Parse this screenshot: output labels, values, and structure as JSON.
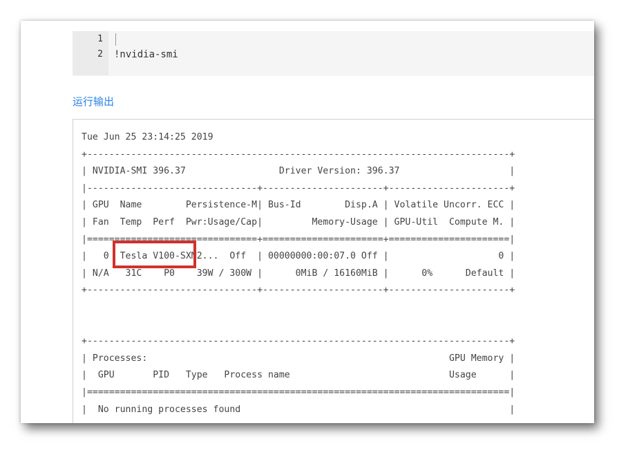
{
  "code_cell": {
    "line_numbers": [
      "1",
      "2"
    ],
    "lines": [
      "",
      "!nvidia-smi"
    ]
  },
  "output_section": {
    "label": "运行输出"
  },
  "output_text": "Tue Jun 25 23:14:25 2019\n+-----------------------------------------------------------------------------+\n| NVIDIA-SMI 396.37                 Driver Version: 396.37                    |\n|-------------------------------+----------------------+----------------------+\n| GPU  Name        Persistence-M| Bus-Id        Disp.A | Volatile Uncorr. ECC |\n| Fan  Temp  Perf  Pwr:Usage/Cap|         Memory-Usage | GPU-Util  Compute M. |\n|===============================+======================+======================|\n|   0  Tesla V100-SXM2...  Off  | 00000000:00:07.0 Off |                    0 |\n| N/A   31C    P0    39W / 300W |      0MiB / 16160MiB |      0%      Default |\n+-------------------------------+----------------------+----------------------+\n\n\n+-----------------------------------------------------------------------------+\n| Processes:                                                       GPU Memory |\n|  GPU       PID   Type   Process name                             Usage      |\n|=============================================================================|\n|  No running processes found                                                 |\n+-----------------------------------------------------------------------------+",
  "colors": {
    "link": "#2a82e4",
    "highlight": "#d0312d",
    "code_bg": "#f5f5f5",
    "gutter_bg": "#ebebeb"
  }
}
